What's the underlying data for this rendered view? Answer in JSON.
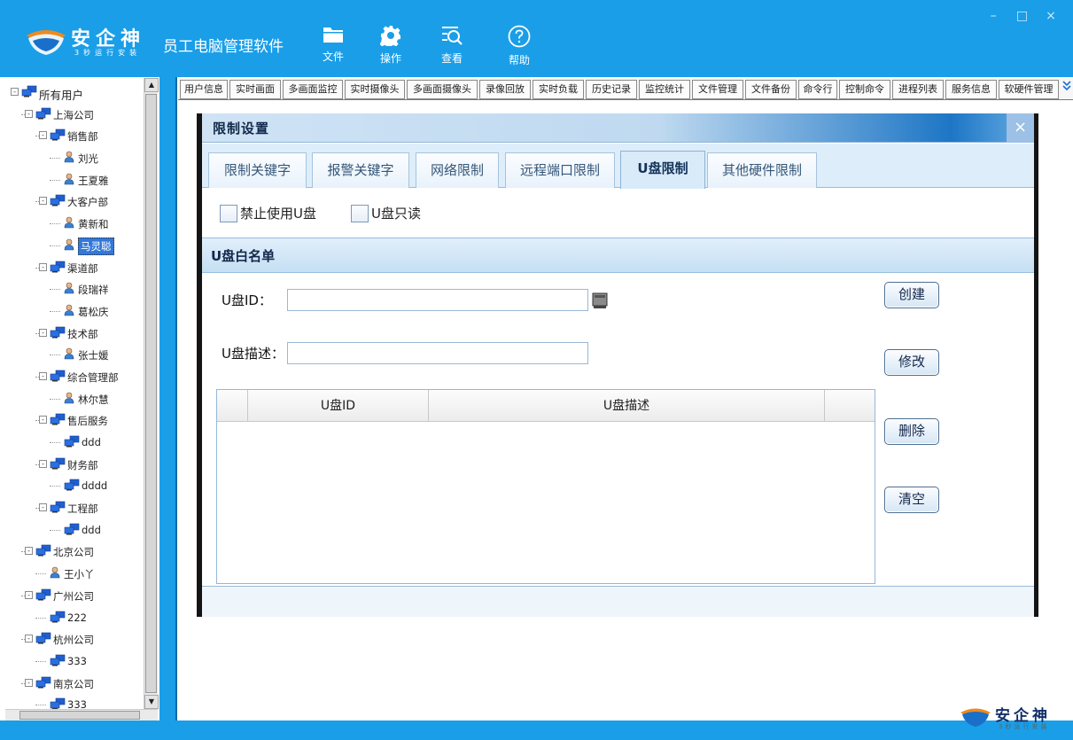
{
  "app": {
    "logo_name": "安企神",
    "logo_slogan": "3秒运行安装",
    "title": "员工电脑管理软件",
    "menu": [
      {
        "label": "文件",
        "icon": "folder-icon"
      },
      {
        "label": "操作",
        "icon": "gear-icon"
      },
      {
        "label": "查看",
        "icon": "view-search-icon"
      },
      {
        "label": "帮助",
        "icon": "help-icon"
      }
    ],
    "window_controls": {
      "minimize": "–",
      "maximize": "□",
      "close": "×"
    }
  },
  "tree": {
    "nodes": [
      {
        "label": "所有用户",
        "type": "group",
        "level": 0,
        "toggle": "-"
      },
      {
        "label": "上海公司",
        "type": "group",
        "level": 1,
        "toggle": "-"
      },
      {
        "label": "销售部",
        "type": "group",
        "level": 2,
        "toggle": "-"
      },
      {
        "label": "刘光",
        "type": "user",
        "level": 3
      },
      {
        "label": "王夏雅",
        "type": "user",
        "level": 3
      },
      {
        "label": "大客户部",
        "type": "group",
        "level": 2,
        "toggle": "-"
      },
      {
        "label": "黄新和",
        "type": "user",
        "level": 3
      },
      {
        "label": "马灵聪",
        "type": "user",
        "level": 3,
        "selected": true
      },
      {
        "label": "渠道部",
        "type": "group",
        "level": 2,
        "toggle": "-"
      },
      {
        "label": "段瑞祥",
        "type": "user",
        "level": 3
      },
      {
        "label": "葛松庆",
        "type": "user",
        "level": 3
      },
      {
        "label": "技术部",
        "type": "group",
        "level": 2,
        "toggle": "-"
      },
      {
        "label": "张士媛",
        "type": "user",
        "level": 3
      },
      {
        "label": "综合管理部",
        "type": "group",
        "level": 2,
        "toggle": "-"
      },
      {
        "label": "林尔慧",
        "type": "user",
        "level": 3
      },
      {
        "label": "售后服务",
        "type": "group",
        "level": 2,
        "toggle": "-"
      },
      {
        "label": "ddd",
        "type": "group",
        "level": 3
      },
      {
        "label": "财务部",
        "type": "group",
        "level": 2,
        "toggle": "-"
      },
      {
        "label": "dddd",
        "type": "group",
        "level": 3
      },
      {
        "label": "工程部",
        "type": "group",
        "level": 2,
        "toggle": "-"
      },
      {
        "label": "ddd",
        "type": "group",
        "level": 3
      },
      {
        "label": "北京公司",
        "type": "group",
        "level": 1,
        "toggle": "-"
      },
      {
        "label": "王小丫",
        "type": "user",
        "level": 2
      },
      {
        "label": "广州公司",
        "type": "group",
        "level": 1,
        "toggle": "-"
      },
      {
        "label": "222",
        "type": "group",
        "level": 2
      },
      {
        "label": "杭州公司",
        "type": "group",
        "level": 1,
        "toggle": "-"
      },
      {
        "label": "333",
        "type": "group",
        "level": 2
      },
      {
        "label": "南京公司",
        "type": "group",
        "level": 1,
        "toggle": "-"
      },
      {
        "label": "333",
        "type": "group",
        "level": 2
      }
    ]
  },
  "func_tabs": [
    "用户信息",
    "实时画面",
    "多画面监控",
    "实时摄像头",
    "多画面摄像头",
    "录像回放",
    "实时负载",
    "历史记录",
    "监控统计",
    "文件管理",
    "文件备份",
    "命令行",
    "控制命令",
    "进程列表",
    "服务信息",
    "软硬件管理"
  ],
  "func_tabs_more": "»",
  "dialog": {
    "title": "限制设置",
    "close": "×",
    "sub_tabs": [
      {
        "label": "限制关键字",
        "active": false
      },
      {
        "label": "报警关键字",
        "active": false
      },
      {
        "label": "网络限制",
        "active": false
      },
      {
        "label": "远程端口限制",
        "active": false
      },
      {
        "label": "U盘限制",
        "active": true
      },
      {
        "label": "其他硬件限制",
        "active": false
      }
    ],
    "checkboxes": [
      {
        "label": "禁止使用U盘",
        "checked": false
      },
      {
        "label": "U盘只读",
        "checked": false
      }
    ],
    "whitelist_title": "U盘白名单",
    "usb_id_label": "U盘ID：",
    "usb_id_value": "",
    "usb_desc_label": "U盘描述：",
    "usb_desc_value": "",
    "buttons": {
      "create": "创建",
      "modify": "修改",
      "delete": "删除",
      "clear": "清空"
    },
    "table": {
      "columns": [
        "",
        "U盘ID",
        "U盘描述",
        ""
      ],
      "rows": []
    }
  },
  "colors": {
    "header_blue": "#1a9ee8",
    "selection_blue": "#3378d9",
    "dialog_border": "#141414"
  }
}
